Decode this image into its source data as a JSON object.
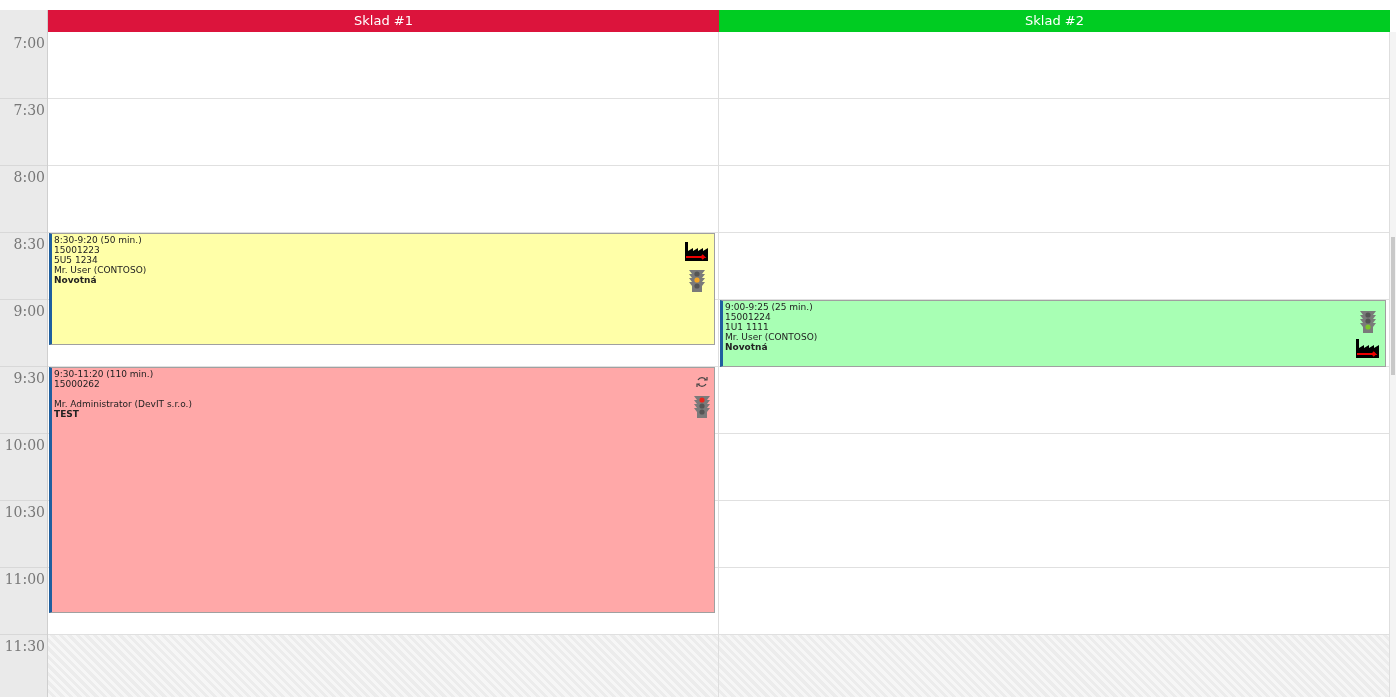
{
  "columns": [
    {
      "title": "Sklad #1",
      "color": "#dc143c",
      "events": [
        {
          "time": "8:30-9:20 (50 min.)",
          "order": "15001223",
          "plate": "5U5 1234",
          "driver": "Mr. User (CONTOSO)",
          "name": "Novotná",
          "color": "#ffffa8",
          "icons": [
            {
              "kind": "factory"
            },
            {
              "kind": "traffic-light",
              "color": "#f5a623"
            }
          ]
        },
        {
          "time": "9:30-11:20 (110 min.)",
          "order": "15000262",
          "driver": "Mr. Administrator (DevIT s.r.o.)",
          "name": "TEST",
          "color": "#ffa8a8",
          "icons": [
            {
              "kind": "sync"
            },
            {
              "kind": "traffic-light",
              "color": "#e8261c"
            }
          ]
        }
      ]
    },
    {
      "title": "Sklad #2",
      "color": "#00cc22",
      "events": [
        {
          "time": "9:00-9:25 (25 min.)",
          "order": "15001224",
          "plate": "1U1 1111",
          "driver": "Mr. User (CONTOSO)",
          "name": "Novotná",
          "color": "#a8ffb4",
          "icons": [
            {
              "kind": "traffic-light",
              "color": "#7cc42a"
            },
            {
              "kind": "factory"
            }
          ]
        }
      ]
    }
  ],
  "slots": [
    {
      "label": "7:00",
      "closed": false
    },
    {
      "label": "7:30",
      "closed": false
    },
    {
      "label": "8:00",
      "closed": false
    },
    {
      "label": "8:30",
      "closed": false
    },
    {
      "label": "9:00",
      "closed": false
    },
    {
      "label": "9:30",
      "closed": false
    },
    {
      "label": "10:00",
      "closed": false
    },
    {
      "label": "10:30",
      "closed": false
    },
    {
      "label": "11:00",
      "closed": false
    },
    {
      "label": "11:30",
      "closed": true
    }
  ]
}
